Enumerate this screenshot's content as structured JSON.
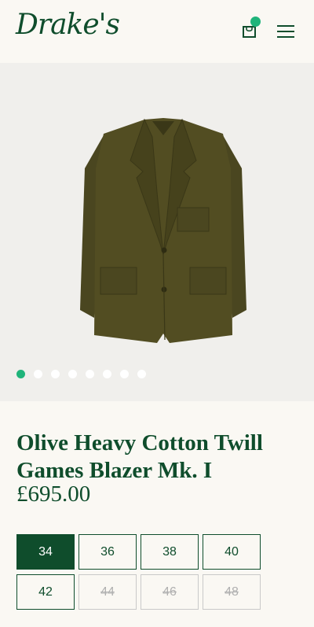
{
  "header": {
    "logo": "Drake's",
    "icons": [
      "bag-icon",
      "menu-icon"
    ],
    "cart_indicator_color": "#1fb47a"
  },
  "gallery": {
    "image": "olive-blazer-image",
    "slide_count": 8,
    "active_slide": 1
  },
  "product": {
    "title": "Olive Heavy Cotton Twill Games Blazer Mk. I",
    "price": "£695.00"
  },
  "sizes": [
    {
      "label": "34",
      "state": "selected"
    },
    {
      "label": "36",
      "state": "available"
    },
    {
      "label": "38",
      "state": "available"
    },
    {
      "label": "40",
      "state": "available"
    },
    {
      "label": "42",
      "state": "available"
    },
    {
      "label": "44",
      "state": "unavailable"
    },
    {
      "label": "46",
      "state": "unavailable"
    },
    {
      "label": "48",
      "state": "unavailable"
    }
  ],
  "colors": {
    "brand_green": "#0f4d2c",
    "accent": "#1fb47a",
    "background": "#faf8f3",
    "gallery_bg": "#f0efec",
    "jacket": "#4e4a1e"
  }
}
